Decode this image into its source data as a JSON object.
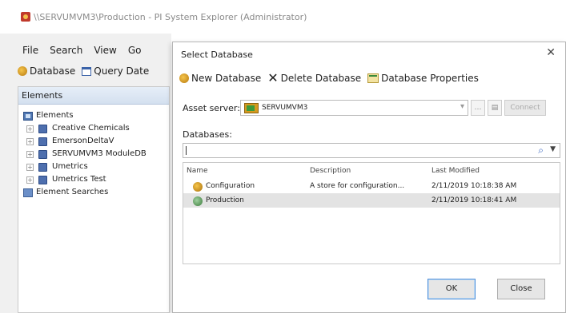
{
  "window": {
    "title": "\\\\SERVUMVM3\\Production - PI System Explorer (Administrator)"
  },
  "menu": [
    "File",
    "Search",
    "View",
    "Go"
  ],
  "toolbar": {
    "database_label": "Database",
    "query_date_label": "Query Date"
  },
  "elements_panel": {
    "header": "Elements",
    "root": "Elements",
    "children": [
      "Creative Chemicals",
      "EmersonDeltaV",
      "SERVUMVM3 ModuleDB",
      "Umetrics",
      "Umetrics Test"
    ],
    "searches": "Element Searches"
  },
  "dialog": {
    "title": "Select Database",
    "close_glyph": "✕",
    "toolbar": {
      "new_database": "New Database",
      "delete_database": "Delete Database",
      "database_properties": "Database Properties"
    },
    "asset_server_label": "Asset server:",
    "asset_server_value": "SERVUMVM3",
    "connect_label": "Connect",
    "databases_label": "Databases:",
    "search_value": "",
    "columns": [
      "Name",
      "Description",
      "Last Modified"
    ],
    "rows": [
      {
        "name": "Configuration",
        "description": "A store for configuration...",
        "modified": "2/11/2019 10:18:38 AM"
      },
      {
        "name": "Production",
        "description": "",
        "modified": "2/11/2019 10:18:41 AM"
      }
    ],
    "ok_label": "OK",
    "close_label": "Close"
  },
  "colors": {
    "selected_row": "#e3e3e3",
    "ok_border": "#4f8fd8",
    "panel_header": "#d4e0ef"
  },
  "icons": {
    "app": "pi-explorer-icon",
    "database": "database-icon",
    "query_date": "calendar-icon",
    "delete": "x-icon",
    "properties": "properties-icon",
    "search": "search-icon"
  }
}
